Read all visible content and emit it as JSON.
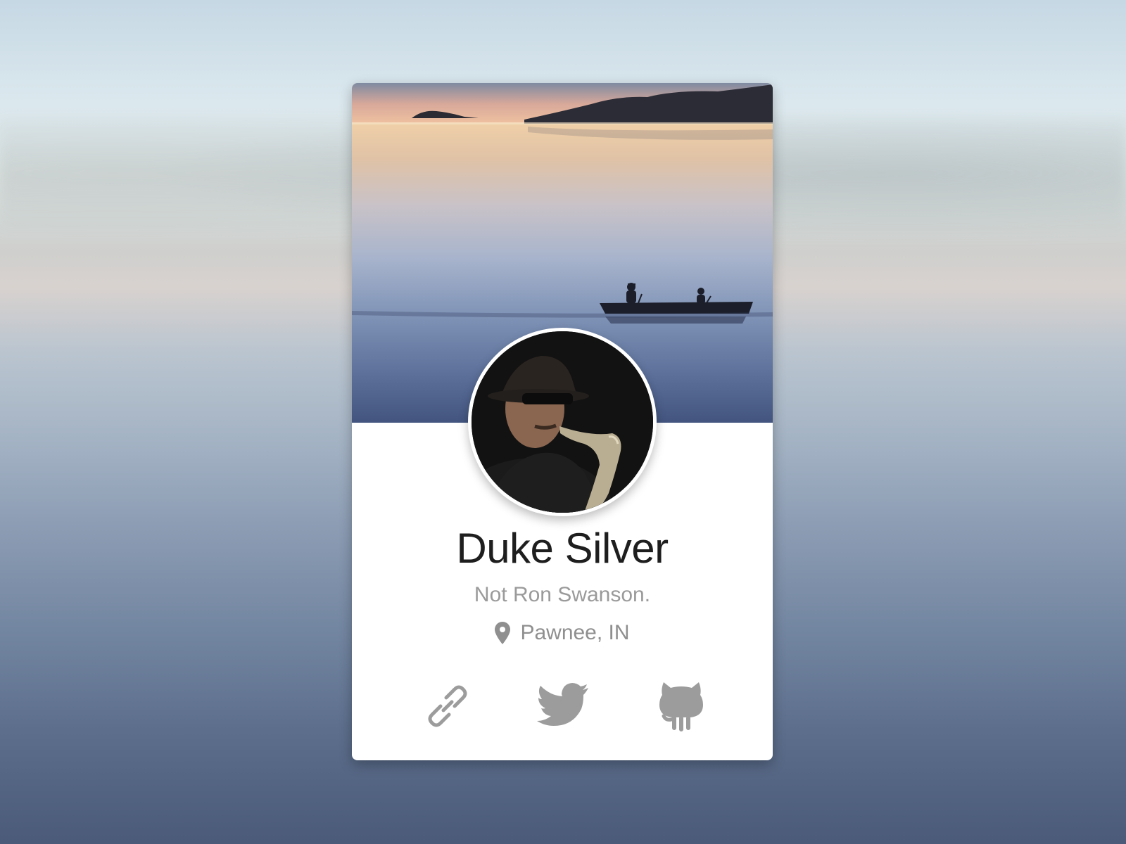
{
  "profile": {
    "name": "Duke Silver",
    "tagline": "Not Ron Swanson.",
    "location": "Pawnee, IN"
  },
  "icons": {
    "location": "location-pin-icon",
    "link": "link-icon",
    "twitter": "twitter-bird-icon",
    "github": "github-octocat-icon"
  },
  "colors": {
    "name_text": "#1e1e1e",
    "secondary_text": "#9a9a9a",
    "icon_gray": "#9a9a9a",
    "card_background": "#ffffff"
  }
}
